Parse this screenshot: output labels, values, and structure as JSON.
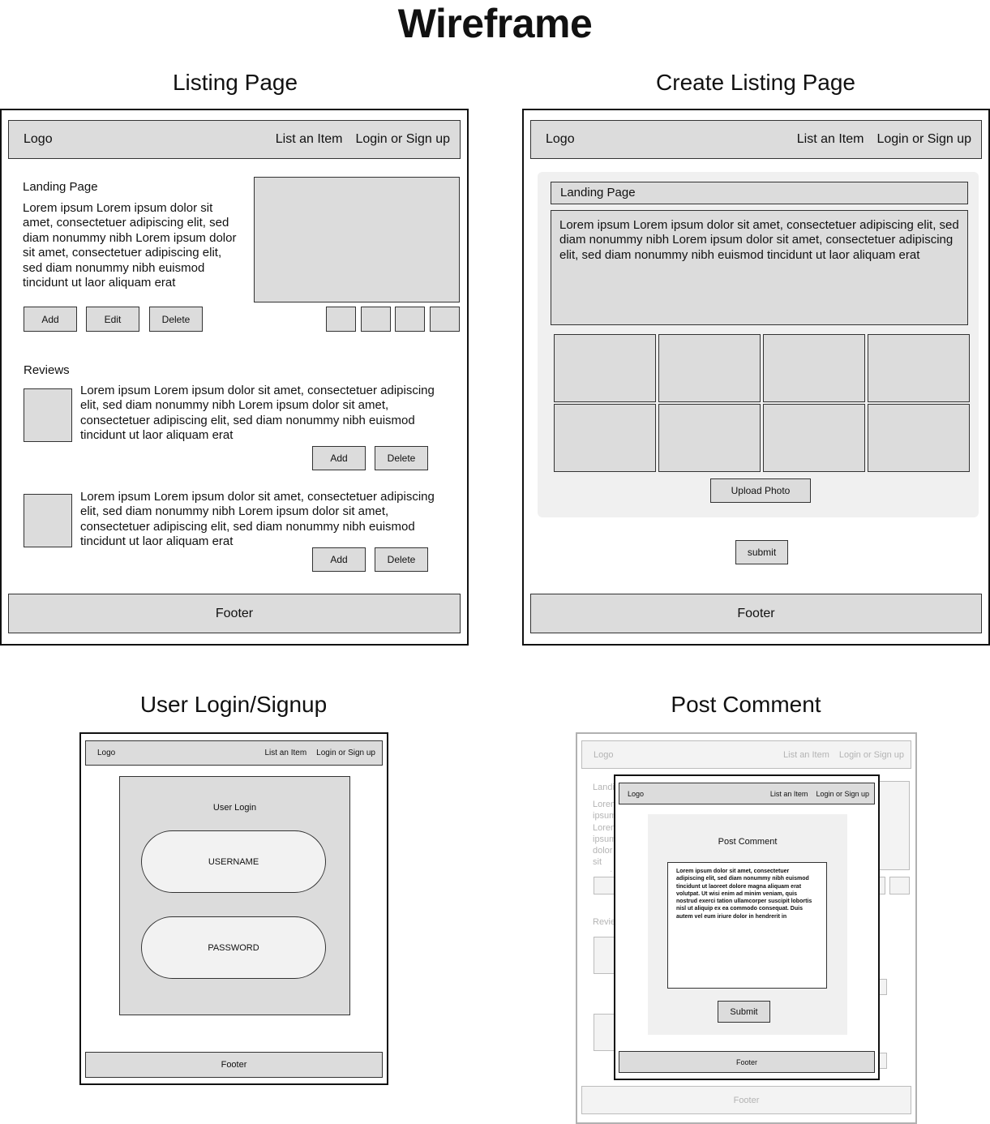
{
  "title": "Wireframe",
  "nav": {
    "logo": "Logo",
    "list_item": "List an Item",
    "login": "Login or Sign up"
  },
  "footer": "Footer",
  "listing": {
    "title": "Listing Page",
    "heading": "Landing Page",
    "body": "Lorem ipsum Lorem ipsum dolor sit amet, consectetuer adipiscing elit, sed diam nonummy nibh Lorem ipsum dolor sit amet, consectetuer adipiscing elit, sed diam nonummy nibh euismod tincidunt ut laor aliquam erat",
    "btn_add": "Add",
    "btn_edit": "Edit",
    "btn_delete": "Delete",
    "reviews_label": "Reviews",
    "review_text": "Lorem ipsum Lorem ipsum dolor sit amet, consectetuer adipiscing elit, sed diam nonummy nibh Lorem ipsum dolor sit amet, consectetuer adipiscing elit, sed diam nonummy nibh euismod tincidunt ut laor aliquam erat"
  },
  "create": {
    "title": "Create Listing Page",
    "heading": "Landing Page",
    "body": "Lorem ipsum Lorem ipsum dolor sit amet, consectetuer adipiscing elit, sed diam nonummy nibh Lorem ipsum dolor sit amet, consectetuer adipiscing elit, sed diam nonummy nibh euismod tincidunt ut laor aliquam erat",
    "upload": "Upload Photo",
    "submit": "submit"
  },
  "login": {
    "title": "User Login/Signup",
    "heading": "User Login",
    "username": "USERNAME",
    "password": "PASSWORD"
  },
  "comment": {
    "title": "Post Comment",
    "heading": "Post Comment",
    "body": "Lorem ipsum dolor sit amet, consectetuer adipiscing elit, sed diam nonummy nibh euismod tincidunt ut laoreet dolore magna aliquam erat volutpat. Ut wisi enim ad minim veniam, quis nostrud exerci tation ullamcorper suscipit lobortis nisl ut aliquip ex ea commodo consequat. Duis autem vel eum iriure dolor in hendrerit in",
    "submit": "Submit"
  }
}
